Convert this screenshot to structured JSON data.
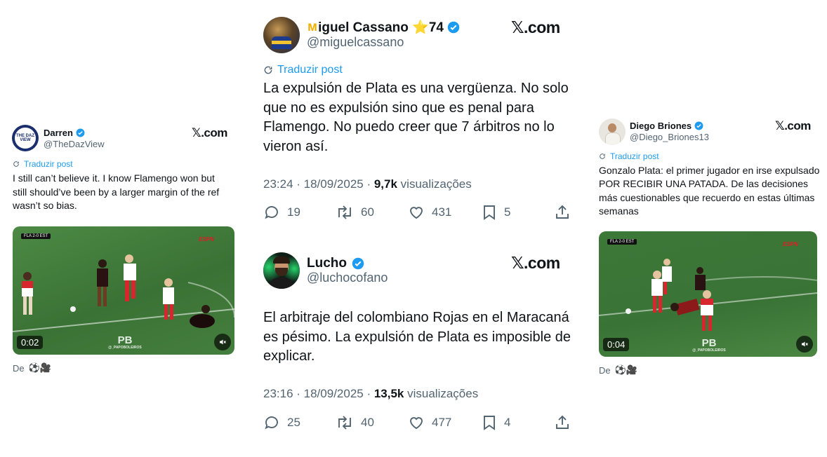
{
  "colors": {
    "accent": "#1d9bf0",
    "muted": "#536471",
    "text": "#0f1419",
    "pitch": "#3f7a3a"
  },
  "tweet_left": {
    "name": "Darren",
    "handle": "@TheDazView",
    "avatar_text": "THE DAZ VIEW",
    "site": ".com",
    "translate": "Traduzir post",
    "text": "I still can’t believe it. I know Flamengo won but still should’ve been by a larger margin of the ref wasn’t so bias.",
    "video": {
      "time": "0:02",
      "score": "FLA 2-0 EST",
      "watermark": "PB",
      "watermark_sub": "@_PAPOBOLEIROS",
      "broadcaster": "ESPN"
    },
    "from_label": "De",
    "from_icons": "⚽🎥"
  },
  "tweet_top": {
    "name": "iguel Cassano ⭐74",
    "handle": "@miguelcassano",
    "site": ".com",
    "translate": "Traduzir post",
    "text": "La expulsión de Plata es una vergüenza. No solo que no es expulsión sino que es penal para Flamengo. No puedo creer que 7 árbitros no lo vieron así.",
    "meta_time": "23:24 · 18/09/2025 · ",
    "meta_views": "9,7k",
    "meta_views_label": " visualizações",
    "replies": "19",
    "retweets": "60",
    "likes": "431",
    "bookmarks": "5"
  },
  "tweet_mid": {
    "name": "Lucho",
    "handle": "@luchocofano",
    "site": ".com",
    "text": "El arbitraje del colombiano Rojas en el Maracaná es pésimo. La expulsión de Plata es imposible de explicar.",
    "meta_time": "23:16 · 18/09/2025 · ",
    "meta_views": "13,5k",
    "meta_views_label": " visualizações",
    "replies": "25",
    "retweets": "40",
    "likes": "477",
    "bookmarks": "4"
  },
  "tweet_right": {
    "name": "Diego Briones",
    "handle": "@Diego_Briones13",
    "site": ".com",
    "translate": "Traduzir post",
    "text": "Gonzalo Plata: el primer jugador en irse expulsado POR RECIBIR UNA PATADA. De las decisiones más cuestionables que recuerdo en estas últimas semanas",
    "video": {
      "time": "0:04",
      "score": "FLA 2-0 EST",
      "watermark": "PB",
      "watermark_sub": "@_PAPOBOLEIROS",
      "broadcaster": "ESPN"
    },
    "from_label": "De",
    "from_icons": "⚽🎥"
  }
}
